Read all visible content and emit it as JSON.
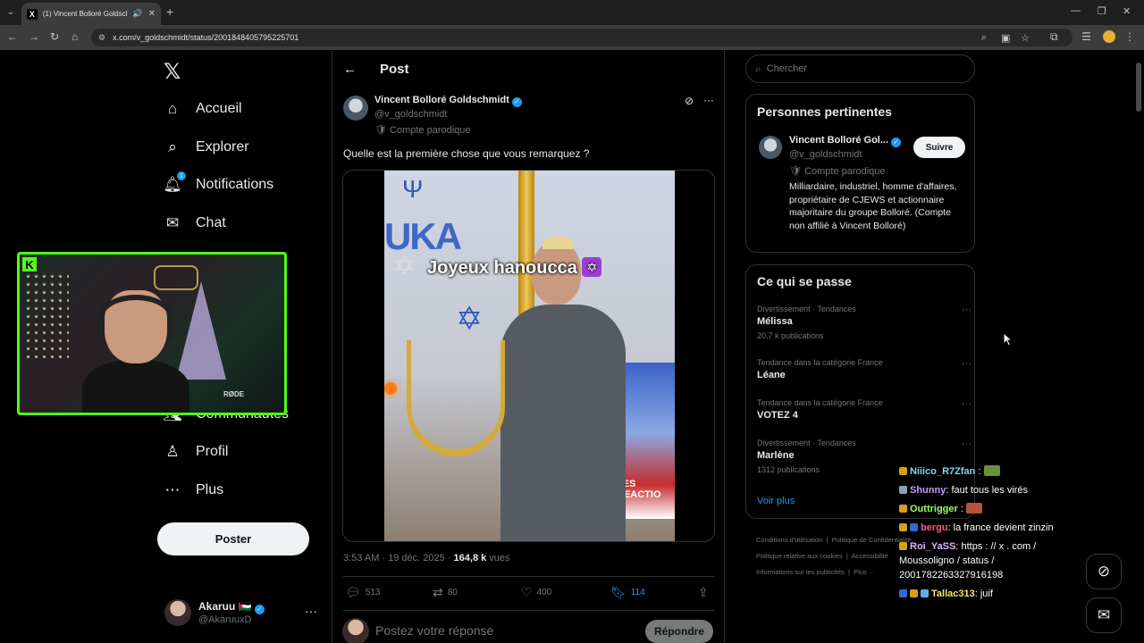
{
  "browser": {
    "tab_title": "(1) Vincent Bolloré Goldschmidt",
    "url": "x.com/v_goldschmidt/status/2001848405795225701"
  },
  "nav": {
    "items": [
      {
        "label": "Accueil",
        "icon": "home-icon"
      },
      {
        "label": "Explorer",
        "icon": "search-icon"
      },
      {
        "label": "Notifications",
        "icon": "bell-icon",
        "badge": "1"
      },
      {
        "label": "Chat",
        "icon": "mail-icon"
      },
      {
        "label": "Communautés",
        "icon": "communities-icon"
      },
      {
        "label": "Profil",
        "icon": "person-icon"
      },
      {
        "label": "Plus",
        "icon": "more-circle-icon"
      }
    ],
    "post_button": "Poster",
    "account": {
      "name": "Akaruu",
      "flag": "🇵🇸",
      "handle": "@AkaruuxD"
    }
  },
  "post": {
    "header_title": "Post",
    "author": {
      "name": "Vincent Bolloré Goldschmidt",
      "handle": "@v_goldschmidt",
      "label": "Compte parodique"
    },
    "text": "Quelle est la première chose que vous remarquez  ?",
    "media": {
      "caption": "Joyeux hanoucca",
      "caption_emoji": "✡",
      "bg_text": "UKA",
      "tv_text": "LES REACTIO"
    },
    "time": "3:53 AM · 19 déc. 2025 · ",
    "views_count": "164,8 k",
    "views_label": " vues",
    "stats": {
      "replies": "513",
      "reposts": "80",
      "likes": "400",
      "bookmarks": "114"
    },
    "reply_placeholder": "Postez votre réponse",
    "reply_button": "Répondre"
  },
  "sidebar": {
    "search_placeholder": "Chercher",
    "relevant": {
      "title": "Personnes pertinentes",
      "name": "Vincent Bolloré Gol...",
      "handle": "@v_goldschmidt",
      "label": "Compte parodique",
      "follow": "Suivre",
      "bio": "Milliardaire, industriel, homme d'affaires, propriétaire de CJEWS et actionnaire majoritaire du groupe Bolloré. (Compte non affilié à Vincent Bolloré)"
    },
    "trends": {
      "title": "Ce qui se passe",
      "items": [
        {
          "category": "Divertissement · Tendances",
          "name": "Mélissa",
          "count": "20,7 k publications"
        },
        {
          "category": "Tendance dans la catégorie France",
          "name": "Léane",
          "count": ""
        },
        {
          "category": "Tendance dans la catégorie France",
          "name": "VOTEZ 4",
          "count": ""
        },
        {
          "category": "Divertissement · Tendances",
          "name": "Marlène",
          "count": "1312 publications"
        }
      ],
      "see_more": "Voir plus"
    },
    "footer": {
      "terms": "Conditions d'utilisation",
      "privacy": "Politique de Confidentialité",
      "cookies": "Politique relative aux cookies",
      "accessibility": "Accessibilité",
      "ads": "Informations sur les publicités",
      "more": "Plus ···"
    }
  },
  "chat": [
    {
      "user": "Niiico_R7Zfan",
      "color": "#7ad9ff",
      "msg": ":"
    },
    {
      "user": "Shunny",
      "color": "#c59bff",
      "msg": ": faut tous les virés"
    },
    {
      "user": "Outtrigger",
      "color": "#9bff6a",
      "msg": ":"
    },
    {
      "user": "bergu",
      "color": "#ff5a8a",
      "msg": ": la france devient zinzin"
    },
    {
      "user": "Roi_YaSS",
      "color": "#d6b8ff",
      "msg": ": https : // x . com / Moussoligno / status / 2001782263327916198"
    },
    {
      "user": "Tallac313",
      "color": "#ffe26a",
      "msg": ": juif"
    }
  ],
  "colors": {
    "accent": "#1d9bf0",
    "kick_green": "#53fc18"
  }
}
